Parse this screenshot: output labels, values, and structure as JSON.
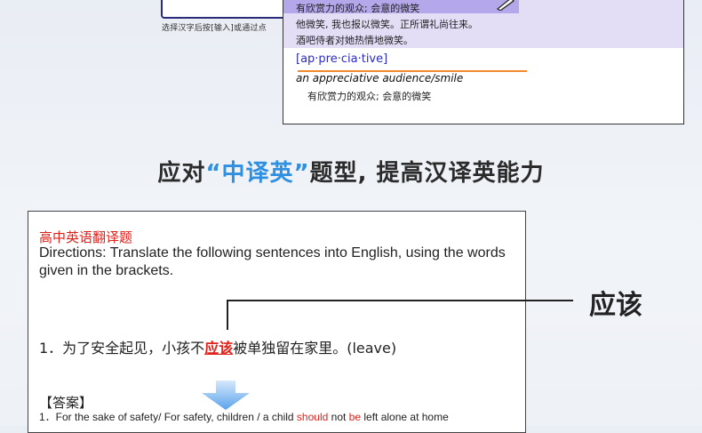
{
  "device_fragment": {
    "hint": "选择汉字后按[输入]或通过点"
  },
  "dictionary": {
    "top_line": "有欣赏力的观众; 会意的微笑",
    "example_cn_1": "他微笑, 我也报以微笑。正所谓礼尚往来。",
    "example_cn_2": "酒吧侍者对她热情地微笑。",
    "pronunciation": "[ap·pre·cia·tive]",
    "example_en_article": "an",
    "example_en": "appreciative audience/smile",
    "example_en_cn": "有欣赏力的观众; 会意的微笑"
  },
  "heading": {
    "part1": "应对",
    "part2": "“中译英”",
    "part3": "题型, 提高汉译英能力"
  },
  "question": {
    "title": "高中英语翻译题",
    "directions": "Directions: Translate the following sentences into English, using the words given in the brackets.",
    "q1_prefix": "1．为了安全起见，小孩不",
    "q1_keyword": "应该",
    "q1_suffix": "被单独留在家里。(leave)",
    "answer_label": "【答案】",
    "a1_part1": "1．For the sake of safety/ For safety, children / a child",
    "a1_should": "should",
    "a1_not": "not",
    "a1_be": "be",
    "a1_rest": "left alone at home"
  },
  "callout": {
    "word": "应该"
  }
}
